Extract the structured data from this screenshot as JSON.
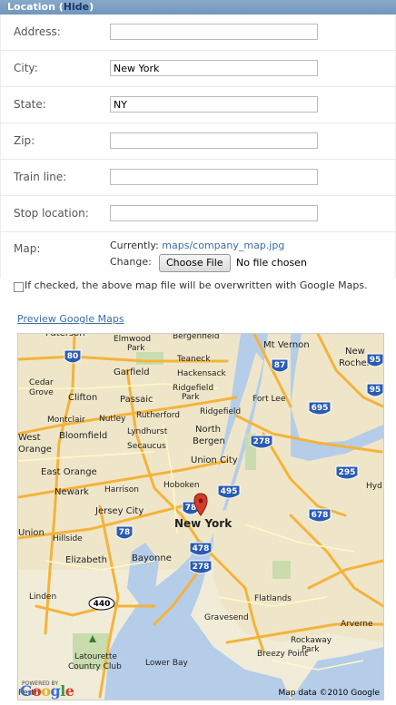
{
  "header": {
    "title": "Location",
    "toggle": "Hide"
  },
  "fields": [
    {
      "label": "Address:",
      "value": ""
    },
    {
      "label": "City:",
      "value": "New York"
    },
    {
      "label": "State:",
      "value": "NY"
    },
    {
      "label": "Zip:",
      "value": ""
    },
    {
      "label": "Train line:",
      "value": ""
    },
    {
      "label": "Stop location:",
      "value": ""
    }
  ],
  "map_field": {
    "label": "Map:",
    "currently_label": "Currently:",
    "currently_link": "maps/company_map.jpg",
    "change_label": "Change:",
    "choose_file": "Choose File",
    "no_file": "No file chosen"
  },
  "overwrite_checkbox": {
    "checked": false,
    "label": "If checked, the above map file will be overwritten with Google Maps."
  },
  "preview_link": "Preview Google Maps",
  "map": {
    "credit": "Map data ©2010 Google",
    "powered_by": "POWERED BY",
    "logo": "Google",
    "places": [
      "Paterson",
      "Elmwood Park",
      "Teaneck",
      "Mt Vernon",
      "New Rochelle",
      "Garfield",
      "Hackensack",
      "Cedar Grove",
      "Ridgefield Park",
      "Clifton",
      "Passaic",
      "Fort Lee",
      "Ridgefield",
      "Montclair",
      "Nutley",
      "Rutherford",
      "Lyndhurst",
      "West Orange",
      "Bloomfield",
      "Secaucus",
      "North Bergen",
      "Union City",
      "East Orange",
      "Newark",
      "Harrison",
      "Hoboken",
      "Jersey City",
      "New York",
      "Union",
      "Hillside",
      "Elizabeth",
      "Bayonne",
      "Linden",
      "Flatlands",
      "Gravesend",
      "Rockaway Park",
      "Breezy Point",
      "Arverne",
      "Lower Bay",
      "Latourette Country Club",
      "Perth",
      "Hyd"
    ],
    "shields": [
      "80",
      "87",
      "95",
      "695",
      "278",
      "78",
      "495",
      "295",
      "678",
      "478",
      "440"
    ]
  }
}
